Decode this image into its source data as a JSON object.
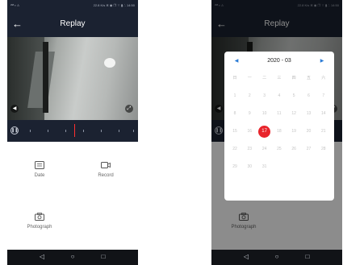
{
  "statusbar": {
    "left": "ᴵᴬᴮ ▪ ⚠",
    "right": "22.8 K/s ✲ ◉ ❐ ⌔ ▮ ∴ 14:50"
  },
  "header": {
    "title": "Replay"
  },
  "actions": {
    "date": "Date",
    "record": "Record",
    "photograph": "Photograph"
  },
  "calendar": {
    "month": "2020 - 03",
    "weekdays": [
      "日",
      "一",
      "二",
      "三",
      "四",
      "五",
      "六"
    ],
    "days": [
      "1",
      "2",
      "3",
      "4",
      "5",
      "6",
      "7",
      "8",
      "9",
      "10",
      "11",
      "12",
      "13",
      "14",
      "15",
      "16",
      "17",
      "18",
      "19",
      "20",
      "21",
      "22",
      "23",
      "24",
      "25",
      "26",
      "27",
      "28",
      "29",
      "30",
      "31"
    ],
    "selected_day": "17",
    "accent": "#e8242b"
  },
  "colors": {
    "bar": "#1b2231",
    "calendar_arrow": "#2a7bd6"
  }
}
